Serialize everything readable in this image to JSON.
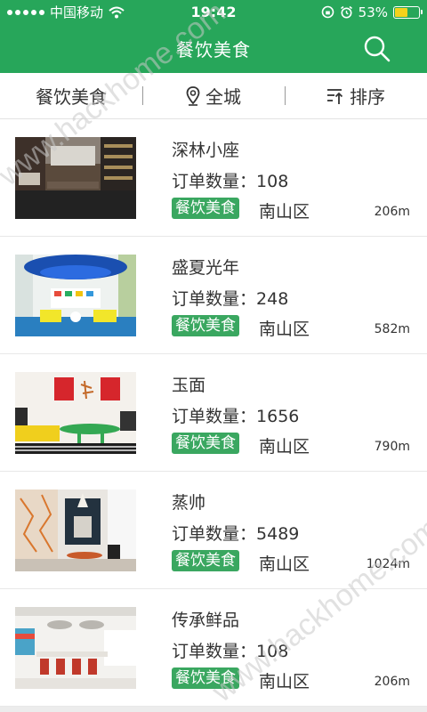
{
  "status_bar": {
    "carrier": "中国移动",
    "time": "19:42",
    "battery_percent": "53%",
    "battery_level": 0.53,
    "colors": {
      "bar": "#27a65a",
      "battery": "#f3d21b"
    }
  },
  "nav": {
    "title": "餐饮美食",
    "search_icon": "search-icon"
  },
  "filters": [
    {
      "label": "餐饮美食",
      "icon": ""
    },
    {
      "label": "全城",
      "icon": "location-pin-icon"
    },
    {
      "label": "排序",
      "icon": "sort-icon"
    }
  ],
  "order_label": "订单数量：",
  "items": [
    {
      "name": "深林小座",
      "orders": "108",
      "tag": "餐饮美食",
      "district": "南山区",
      "distance": "206m"
    },
    {
      "name": "盛夏光年",
      "orders": "248",
      "tag": "餐饮美食",
      "district": "南山区",
      "distance": "582m"
    },
    {
      "name": "玉面",
      "orders": "1656",
      "tag": "餐饮美食",
      "district": "南山区",
      "distance": "790m"
    },
    {
      "name": "蒸帅",
      "orders": "5489",
      "tag": "餐饮美食",
      "district": "南山区",
      "distance": "1024m"
    },
    {
      "name": "传承鲜品",
      "orders": "108",
      "tag": "餐饮美食",
      "district": "南山区",
      "distance": "206m"
    }
  ],
  "watermark": "www.hackhome.com",
  "accent_color": "#27a65a",
  "tag_color": "#3aa760"
}
